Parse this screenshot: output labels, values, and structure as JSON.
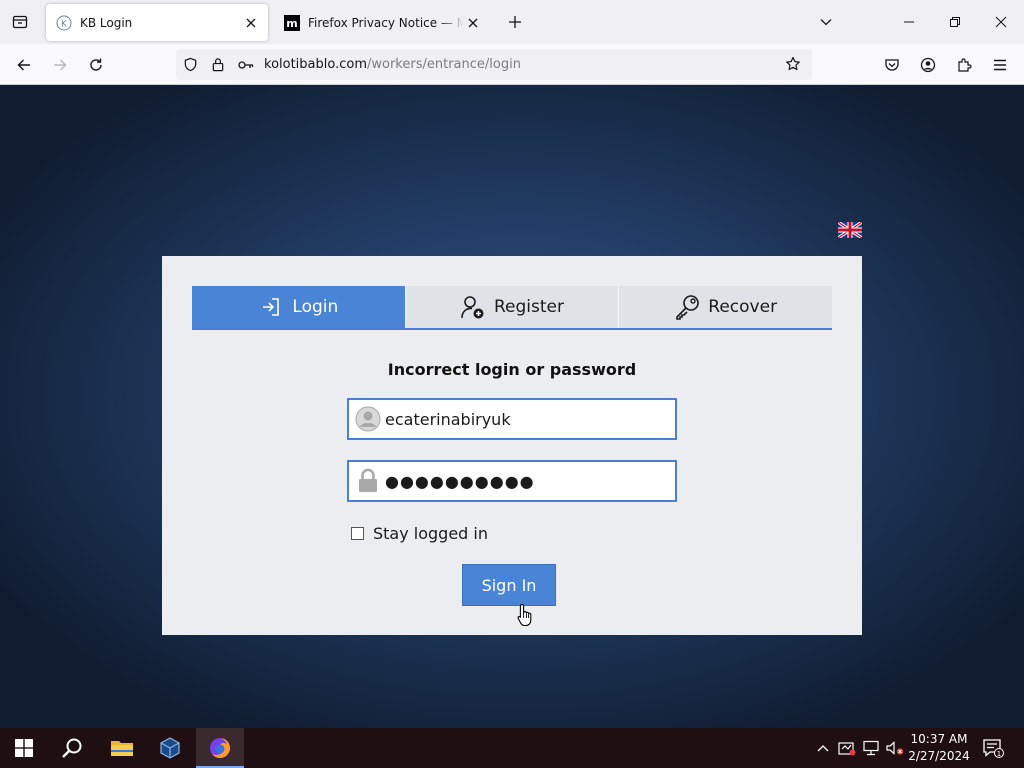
{
  "browser": {
    "tabs": [
      {
        "title": "KB Login",
        "active": true
      },
      {
        "title": "Firefox Privacy Notice — Mozilla",
        "active": false
      }
    ],
    "url": {
      "host": "kolotibablo.com",
      "path": "/workers/entrance/login"
    }
  },
  "page": {
    "nav_tabs": [
      {
        "label": "Login",
        "icon": "login-arrow-icon",
        "active": true
      },
      {
        "label": "Register",
        "icon": "user-add-icon",
        "active": false
      },
      {
        "label": "Recover",
        "icon": "key-icon",
        "active": false
      }
    ],
    "error_message": "Incorrect login or password",
    "username_value": "ecaterinabiryuk",
    "password_value": "●●●●●●●●●●",
    "remember_label": "Stay logged in",
    "remember_checked": false,
    "signin_label": "Sign In",
    "language": "uk-flag-icon"
  },
  "taskbar": {
    "time": "10:37 AM",
    "date": "2/27/2024",
    "notification_count": "1"
  },
  "colors": {
    "accent": "#4a84d6",
    "card_bg": "#ebedf1",
    "taskbar_bg": "#200f12"
  }
}
